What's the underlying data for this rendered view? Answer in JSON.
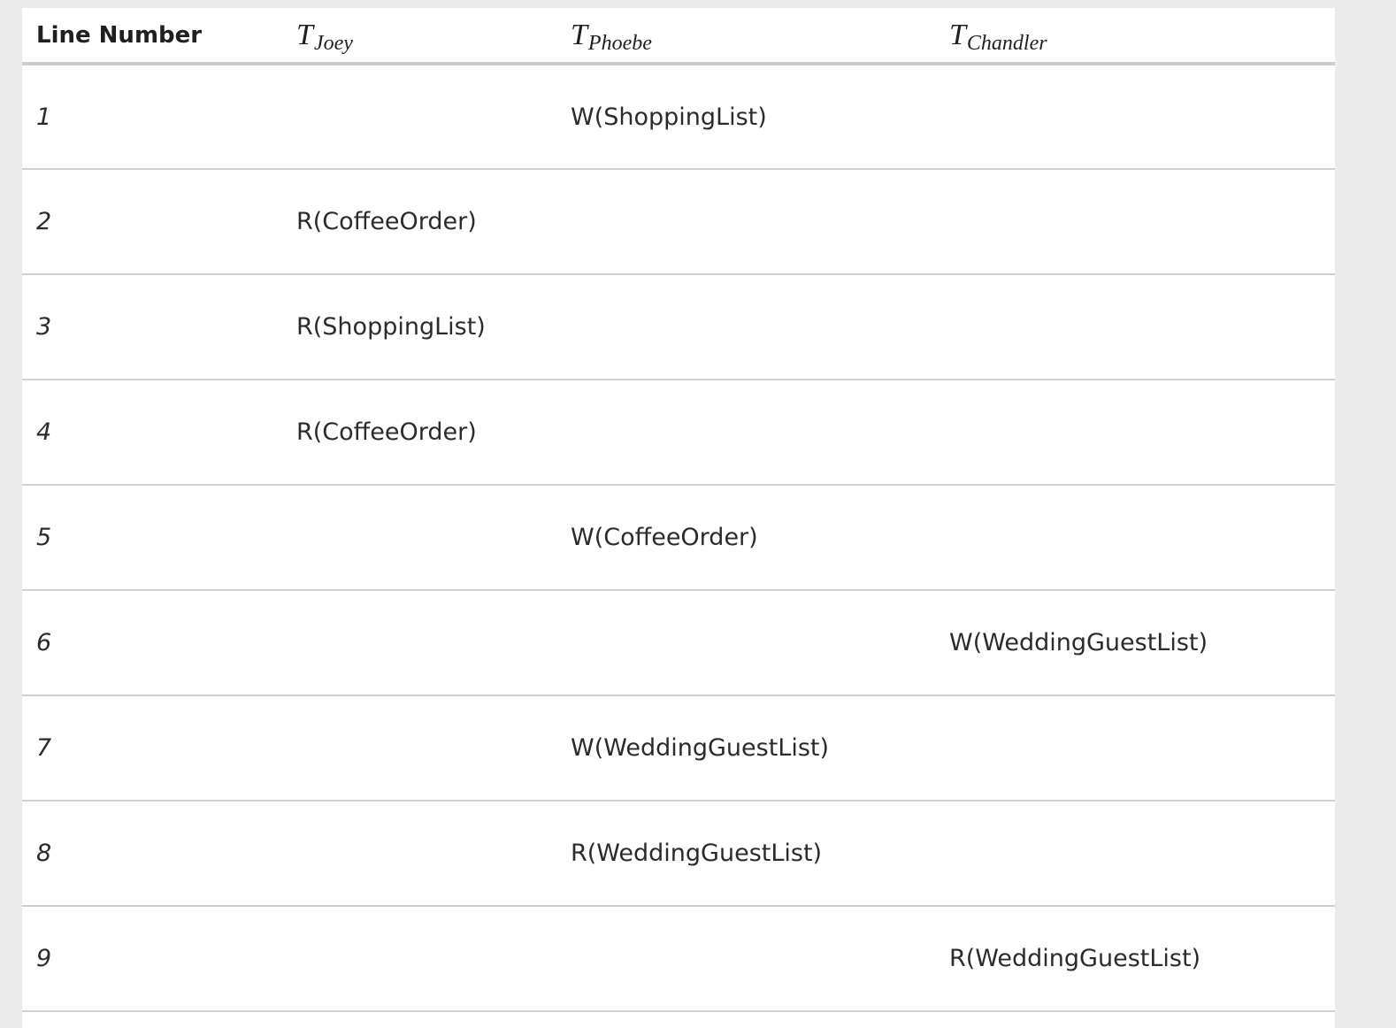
{
  "table": {
    "headers": [
      {
        "kind": "text",
        "label": "Line Number"
      },
      {
        "kind": "math",
        "base": "T",
        "sub": "Joey"
      },
      {
        "kind": "math",
        "base": "T",
        "sub": "Phoebe"
      },
      {
        "kind": "math",
        "base": "T",
        "sub": "Chandler"
      }
    ],
    "rows": [
      {
        "line": "1",
        "joey": "",
        "phoebe": "W(ShoppingList)",
        "chandler": ""
      },
      {
        "line": "2",
        "joey": "R(CoffeeOrder)",
        "phoebe": "",
        "chandler": ""
      },
      {
        "line": "3",
        "joey": "R(ShoppingList)",
        "phoebe": "",
        "chandler": ""
      },
      {
        "line": "4",
        "joey": "R(CoffeeOrder)",
        "phoebe": "",
        "chandler": ""
      },
      {
        "line": "5",
        "joey": "",
        "phoebe": "W(CoffeeOrder)",
        "chandler": ""
      },
      {
        "line": "6",
        "joey": "",
        "phoebe": "",
        "chandler": "W(WeddingGuestList)"
      },
      {
        "line": "7",
        "joey": "",
        "phoebe": "W(WeddingGuestList)",
        "chandler": ""
      },
      {
        "line": "8",
        "joey": "",
        "phoebe": "R(WeddingGuestList)",
        "chandler": ""
      },
      {
        "line": "9",
        "joey": "",
        "phoebe": "",
        "chandler": "R(WeddingGuestList)"
      }
    ]
  }
}
